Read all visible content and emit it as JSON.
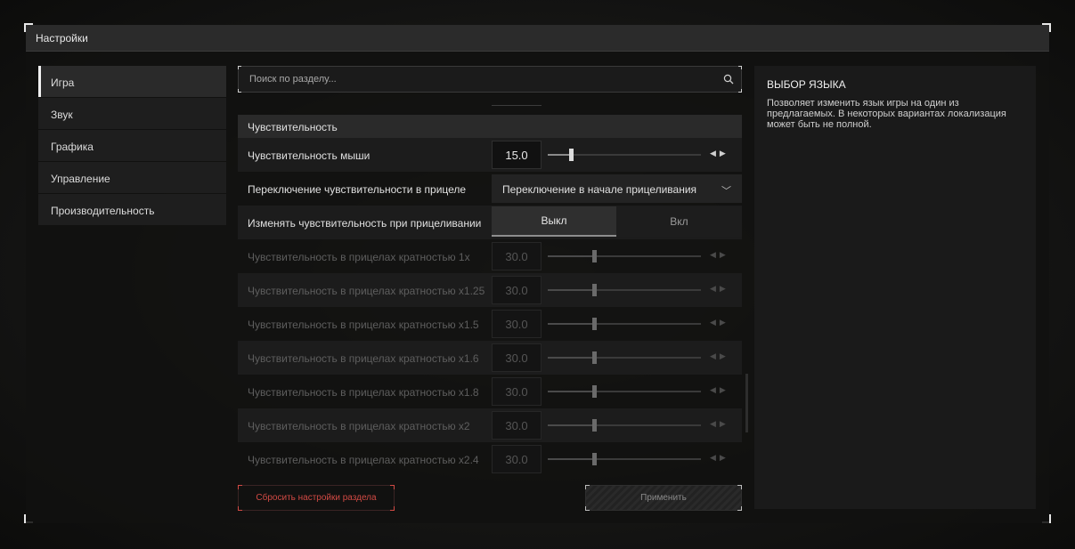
{
  "window": {
    "title": "Настройки"
  },
  "sidebar": {
    "items": [
      {
        "label": "Игра",
        "active": true
      },
      {
        "label": "Звук",
        "active": false
      },
      {
        "label": "Графика",
        "active": false
      },
      {
        "label": "Управление",
        "active": false
      },
      {
        "label": "Производительность",
        "active": false
      }
    ]
  },
  "search": {
    "placeholder": "Поиск по разделу...",
    "icon": "search-icon"
  },
  "section": {
    "title": "Чувствительность"
  },
  "rows": {
    "mouse": {
      "label": "Чувствительность мыши",
      "value": "15.0",
      "fraction": 0.15
    },
    "switch": {
      "label": "Переключение чувствительности в прицеле",
      "value": "Переключение в начале прицеливания"
    },
    "aim_toggle": {
      "label": "Изменять чувствительность при прицеливании",
      "off": "Выкл",
      "on": "Вкл",
      "selected": "Выкл"
    },
    "scopes": [
      {
        "label": "Чувствительность в прицелах кратностью 1x",
        "value": "30.0",
        "fraction": 0.3
      },
      {
        "label": "Чувствительность в прицелах кратностью x1.25",
        "value": "30.0",
        "fraction": 0.3
      },
      {
        "label": "Чувствительность в прицелах кратностью x1.5",
        "value": "30.0",
        "fraction": 0.3
      },
      {
        "label": "Чувствительность в прицелах кратностью x1.6",
        "value": "30.0",
        "fraction": 0.3
      },
      {
        "label": "Чувствительность в прицелах кратностью x1.8",
        "value": "30.0",
        "fraction": 0.3
      },
      {
        "label": "Чувствительность в прицелах кратностью x2",
        "value": "30.0",
        "fraction": 0.3
      },
      {
        "label": "Чувствительность в прицелах кратностью x2.4",
        "value": "30.0",
        "fraction": 0.3
      }
    ]
  },
  "buttons": {
    "reset": "Сбросить настройки раздела",
    "apply": "Применить"
  },
  "info": {
    "title": "ВЫБОР ЯЗЫКА",
    "description": "Позволяет изменить язык игры на один из предлагаемых. В некоторых вариантах локализация может быть не полной."
  },
  "colors": {
    "reset_text": "#d24a44",
    "accent": "#f0f0f0"
  }
}
